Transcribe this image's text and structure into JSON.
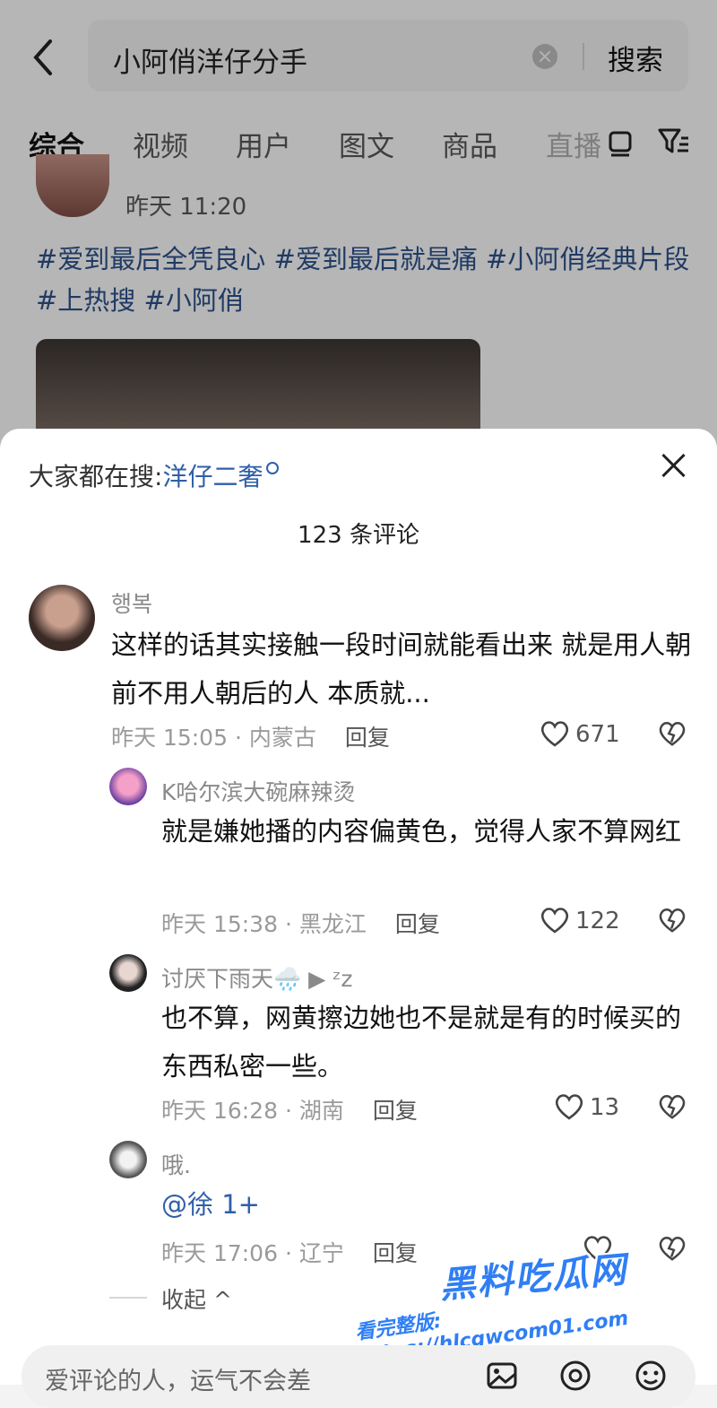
{
  "search": {
    "query": "小阿俏洋仔分手",
    "button": "搜索"
  },
  "tabs": [
    {
      "label": "综合"
    },
    {
      "label": "视频"
    },
    {
      "label": "用户"
    },
    {
      "label": "图文"
    },
    {
      "label": "商品"
    },
    {
      "label": "直播"
    }
  ],
  "post": {
    "time": "昨天 11:20",
    "tags": "#爱到最后全凭良心 #爱到最后就是痛 #小阿俏经典片段  #上热搜 #小阿俏"
  },
  "sheet": {
    "trending_label": "大家都在搜:",
    "trending_link": "洋仔二奢",
    "comment_count": "123 条评论"
  },
  "comments": [
    {
      "name": "행복",
      "text": "这样的话其实接触一段时间就能看出来 就是用人朝前不用人朝后的人 本质就...",
      "meta": "昨天 15:05 · 内蒙古",
      "reply": "回复",
      "likes": "671"
    },
    {
      "name": "K哈尔滨大碗麻辣烫",
      "text": "就是嫌她播的内容偏黄色，觉得人家不算网红",
      "meta": "昨天 15:38 · 黑龙江",
      "reply": "回复",
      "likes": "122"
    },
    {
      "name": "讨厌下雨天🌧️ ▶ ᶻz",
      "text": "也不算，网黄擦边她也不是就是有的时候买的东西私密一些。",
      "meta": "昨天 16:28 · 湖南",
      "reply": "回复",
      "likes": "13"
    },
    {
      "name": "哦.",
      "text": "@徐 1+",
      "meta": "昨天 17:06 · 辽宁",
      "reply": "回复",
      "likes": ""
    }
  ],
  "collapse": "收起 ^",
  "input": {
    "placeholder": "爱评论的人，运气不会差"
  },
  "watermark": {
    "title": "黑料吃瓜网",
    "url": "看完整版: https://hlcgwcom01.com"
  },
  "colors": {
    "link": "#2f5fa8",
    "tag": "#2c4f88",
    "watermark": "#2f7ef5"
  },
  "icons": [
    "back-icon",
    "clear-icon",
    "tab-more-icon",
    "filter-icon",
    "search-mini-icon",
    "close-icon",
    "heart-icon",
    "dislike-icon",
    "image-icon",
    "mention-icon",
    "emoji-icon"
  ]
}
